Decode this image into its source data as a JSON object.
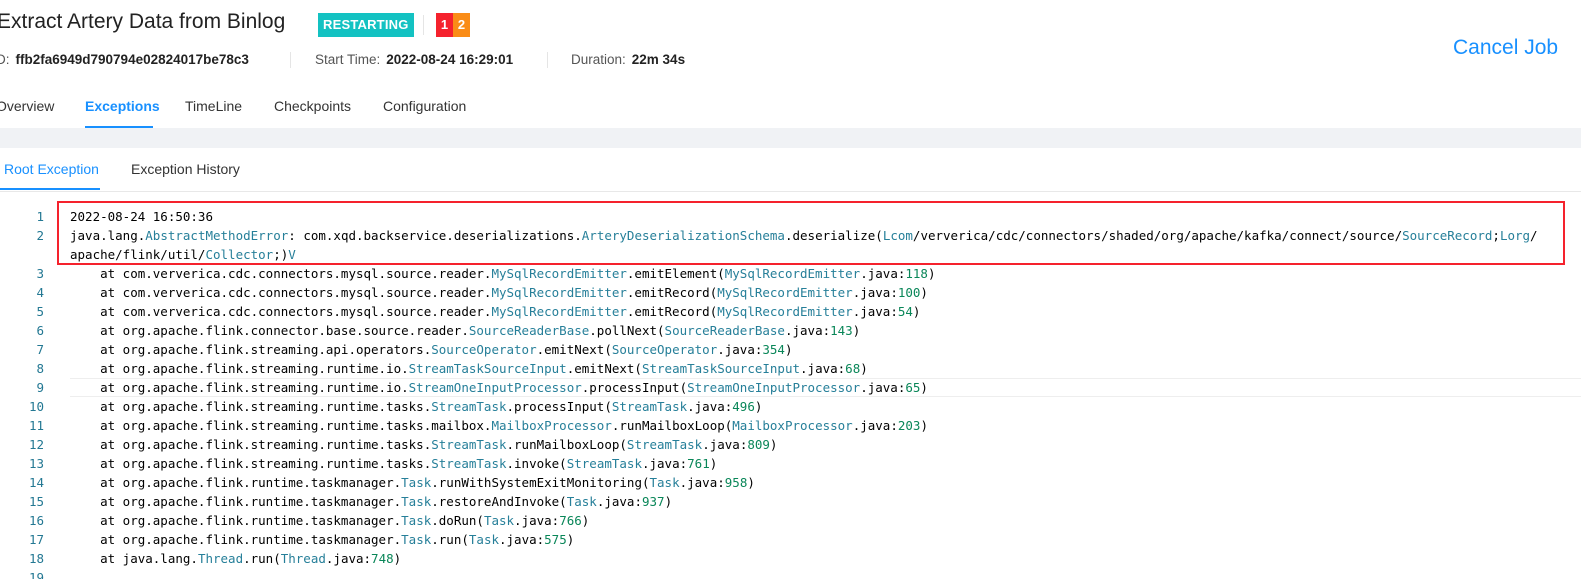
{
  "job": {
    "title": "Extract Artery Data from Binlog",
    "status": "RESTARTING",
    "counts": [
      "1",
      "2"
    ],
    "id_label": "D:",
    "id_value": "ffb2fa6949d790794e02824017be78c3",
    "start_time_label": "Start Time:",
    "start_time_value": "2022-08-24 16:29:01",
    "duration_label": "Duration:",
    "duration_value": "22m 34s",
    "cancel_label": "Cancel Job"
  },
  "tabs": [
    "Overview",
    "Exceptions",
    "TimeLine",
    "Checkpoints",
    "Configuration"
  ],
  "active_tab": "Exceptions",
  "subtabs": [
    "Root Exception",
    "Exception History"
  ],
  "active_subtab": "Root Exception",
  "colors": {
    "accent": "#1890ff",
    "status": "#13c2c2",
    "count1": "#f5222d",
    "count2": "#fa8c16",
    "highlight": "#f5222d"
  },
  "editor": {
    "lines": [
      {
        "n": "1",
        "t": "2022-08-24 16:50:36"
      },
      {
        "n": "2",
        "t": "java.lang.AbstractMethodError: com.xqd.backservice.deserializations.ArteryDeserializationSchema.deserialize(Lcom/ververica/cdc/connectors/shaded/org/apache/kafka/connect/source/SourceRecord;Lorg/"
      },
      {
        "n": "",
        "t": "apache/flink/util/Collector;)V"
      },
      {
        "n": "3",
        "t": "    at com.ververica.cdc.connectors.mysql.source.reader.MySqlRecordEmitter.emitElement(MySqlRecordEmitter.java:118)"
      },
      {
        "n": "4",
        "t": "    at com.ververica.cdc.connectors.mysql.source.reader.MySqlRecordEmitter.emitRecord(MySqlRecordEmitter.java:100)"
      },
      {
        "n": "5",
        "t": "    at com.ververica.cdc.connectors.mysql.source.reader.MySqlRecordEmitter.emitRecord(MySqlRecordEmitter.java:54)"
      },
      {
        "n": "6",
        "t": "    at org.apache.flink.connector.base.source.reader.SourceReaderBase.pollNext(SourceReaderBase.java:143)"
      },
      {
        "n": "7",
        "t": "    at org.apache.flink.streaming.api.operators.SourceOperator.emitNext(SourceOperator.java:354)"
      },
      {
        "n": "8",
        "t": "    at org.apache.flink.streaming.runtime.io.StreamTaskSourceInput.emitNext(StreamTaskSourceInput.java:68)"
      },
      {
        "n": "9",
        "t": "    at org.apache.flink.streaming.runtime.io.StreamOneInputProcessor.processInput(StreamOneInputProcessor.java:65)"
      },
      {
        "n": "10",
        "t": "    at org.apache.flink.streaming.runtime.tasks.StreamTask.processInput(StreamTask.java:496)"
      },
      {
        "n": "11",
        "t": "    at org.apache.flink.streaming.runtime.tasks.mailbox.MailboxProcessor.runMailboxLoop(MailboxProcessor.java:203)"
      },
      {
        "n": "12",
        "t": "    at org.apache.flink.streaming.runtime.tasks.StreamTask.runMailboxLoop(StreamTask.java:809)"
      },
      {
        "n": "13",
        "t": "    at org.apache.flink.streaming.runtime.tasks.StreamTask.invoke(StreamTask.java:761)"
      },
      {
        "n": "14",
        "t": "    at org.apache.flink.runtime.taskmanager.Task.runWithSystemExitMonitoring(Task.java:958)"
      },
      {
        "n": "15",
        "t": "    at org.apache.flink.runtime.taskmanager.Task.restoreAndInvoke(Task.java:937)"
      },
      {
        "n": "16",
        "t": "    at org.apache.flink.runtime.taskmanager.Task.doRun(Task.java:766)"
      },
      {
        "n": "17",
        "t": "    at org.apache.flink.runtime.taskmanager.Task.run(Task.java:575)"
      },
      {
        "n": "18",
        "t": "    at java.lang.Thread.run(Thread.java:748)"
      },
      {
        "n": "19",
        "t": ""
      }
    ]
  }
}
